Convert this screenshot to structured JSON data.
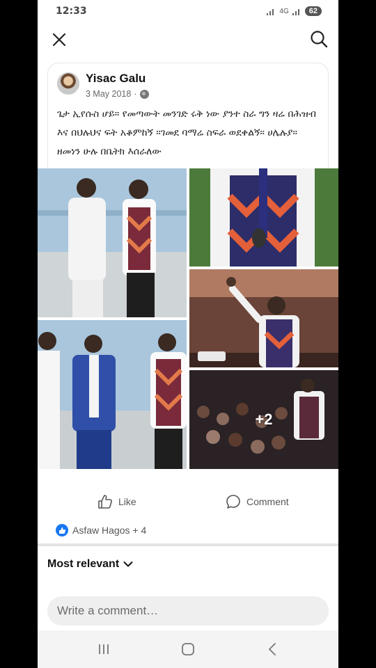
{
  "status_bar": {
    "time": "12:33",
    "network": "4G",
    "battery": "62"
  },
  "post": {
    "author": "Yisac Galu",
    "date": "3 May 2018",
    "date_separator": "·",
    "privacy_icon": "globe-icon",
    "text": "ጌታ ኢየሱስ ሆይ። የመጣውት መንገድ ሩቅ ነው ያንተ ስራ ግን ዛሬ በሕዝብ እና በህሉህና ፍት አቆምከኝ ።ገመደ ባማሬ ስፍራ ወደቀልኝ። ሀሌሉያ።  ዘመነን ሁሉ በቤትክ እሰራለው"
  },
  "photos": {
    "more_count": "+2"
  },
  "actions": {
    "like_label": "Like",
    "comment_label": "Comment"
  },
  "reactions": {
    "summary": "Asfaw Hagos + 4"
  },
  "comments": {
    "sort_label": "Most relevant",
    "input_placeholder": "Write a comment…"
  },
  "colors": {
    "accent": "#1877f2",
    "text": "#111111",
    "muted": "#666666",
    "input_bg": "#efefef"
  }
}
